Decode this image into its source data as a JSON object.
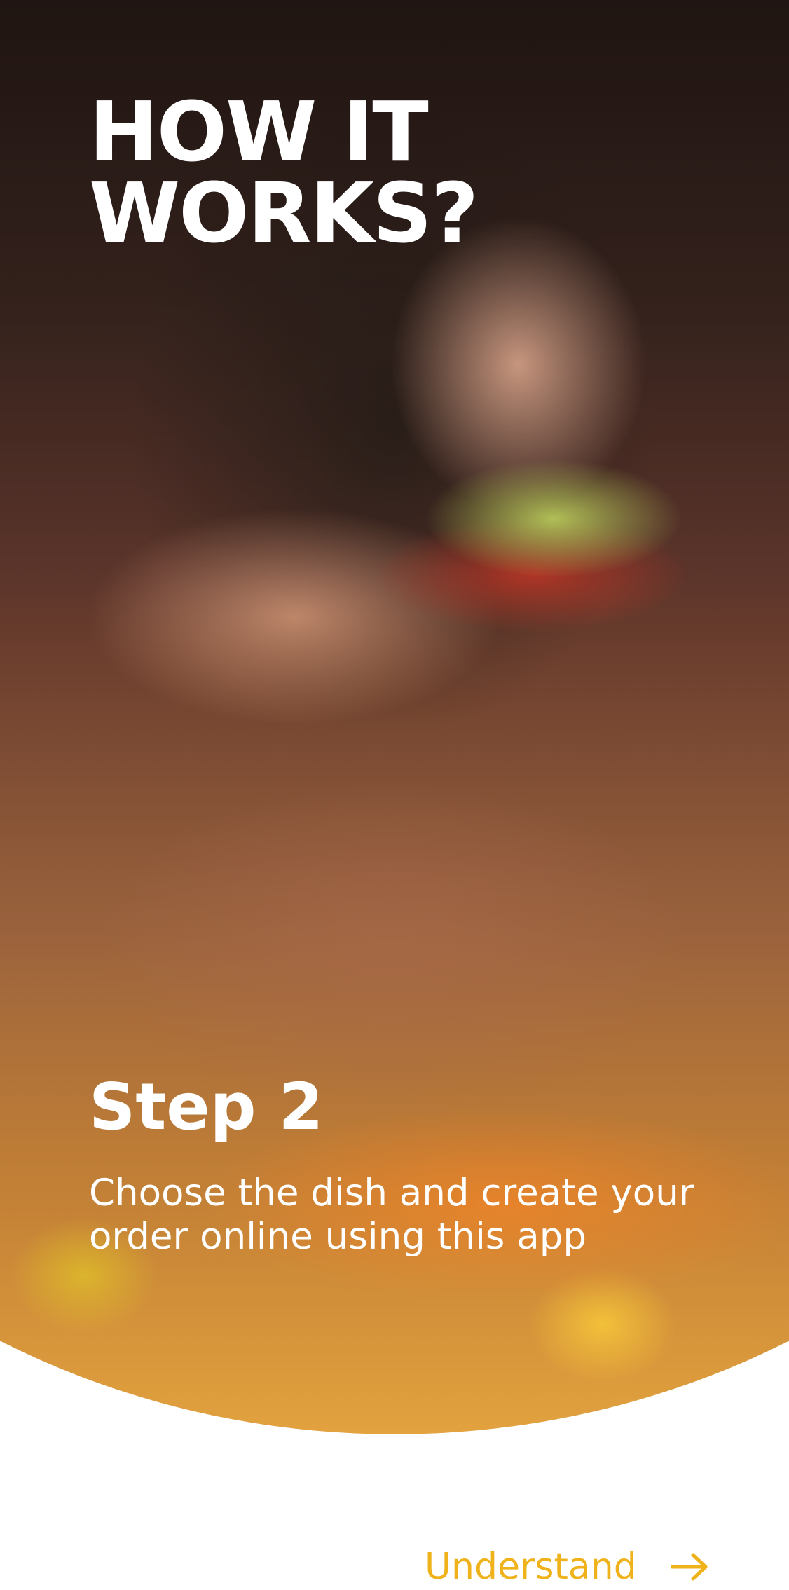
{
  "onboarding": {
    "title": "HOW IT\nWORKS?",
    "step_label": "Step 2",
    "step_description": "Choose the dish and create your order online using this app",
    "hero_image": "woman eating taco photo"
  },
  "actions": {
    "understand_label": "Understand",
    "understand_icon": "arrow-right-icon"
  },
  "colors": {
    "accent": "#F0B21B",
    "text_on_image": "#FFFFFF",
    "background": "#FFFFFF"
  }
}
